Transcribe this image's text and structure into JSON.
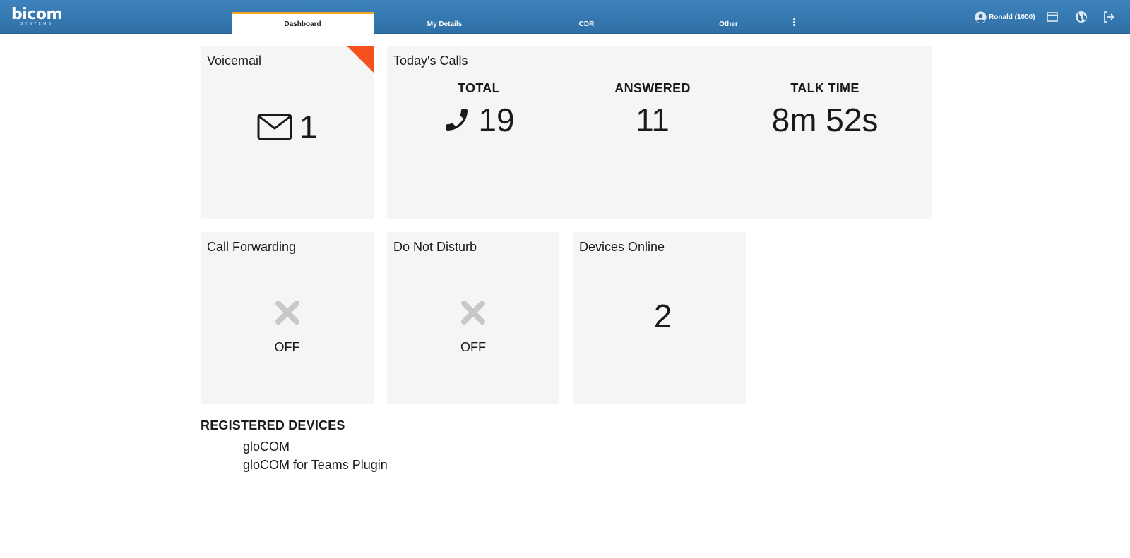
{
  "header": {
    "logo": "bicom",
    "logo_sub": "SYSTEMS",
    "tabs": [
      {
        "label": "Dashboard",
        "active": true
      },
      {
        "label": "My Details",
        "active": false
      },
      {
        "label": "CDR",
        "active": false
      },
      {
        "label": "Other",
        "active": false
      }
    ],
    "more_icon": "vertical-ellipsis-icon",
    "user_label": "Ronald (1000)",
    "icons": [
      "user-circle-icon",
      "window-icon",
      "globe-icon",
      "logout-icon"
    ],
    "colors": {
      "bar": "#3578b2",
      "active_tab_accent": "#f5a623"
    }
  },
  "voicemail": {
    "title": "Voicemail",
    "icon": "envelope-icon",
    "count": "1",
    "corner_color": "#f4511e"
  },
  "todays_calls": {
    "title": "Today's Calls",
    "stats": [
      {
        "label": "TOTAL",
        "value": "19",
        "icon": "phone-icon"
      },
      {
        "label": "ANSWERED",
        "value": "11"
      },
      {
        "label": "TALK TIME",
        "value": "8m 52s"
      }
    ]
  },
  "call_forwarding": {
    "title": "Call Forwarding",
    "icon": "x-icon",
    "status": "OFF"
  },
  "do_not_disturb": {
    "title": "Do Not Disturb",
    "icon": "x-icon",
    "status": "OFF"
  },
  "devices_online": {
    "title": "Devices Online",
    "value": "2"
  },
  "registered_devices": {
    "title": "REGISTERED DEVICES",
    "items": [
      "gloCOM",
      "gloCOM for Teams Plugin"
    ]
  }
}
